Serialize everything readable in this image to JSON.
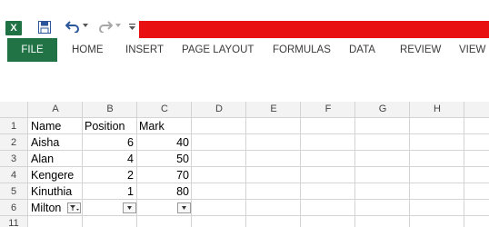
{
  "app": {
    "logo_letter": "X",
    "accent": "#217346",
    "title_bar_color": "#e81010"
  },
  "ribbon": {
    "tabs": [
      {
        "label": "FILE"
      },
      {
        "label": "HOME"
      },
      {
        "label": "INSERT"
      },
      {
        "label": "PAGE LAYOUT"
      },
      {
        "label": "FORMULAS"
      },
      {
        "label": "DATA"
      },
      {
        "label": "REVIEW"
      },
      {
        "label": "VIEW"
      }
    ]
  },
  "sheet": {
    "columns": [
      "A",
      "B",
      "C",
      "D",
      "E",
      "F",
      "G",
      "H"
    ],
    "rows": [
      "1",
      "2",
      "3",
      "4",
      "5",
      "6",
      "11"
    ],
    "cells": {
      "A1": "Name",
      "B1": "Position",
      "C1": "Mark",
      "A2": "Aisha",
      "B2": "6",
      "C2": "40",
      "A3": "Alan",
      "B3": "4",
      "C3": "50",
      "A4": "Kengere",
      "B4": "2",
      "C4": "70",
      "A5": "Kinuthia",
      "B5": "1",
      "C5": "80",
      "A6": "Milton"
    },
    "filter_icons": [
      "filter-active-icon",
      "dropdown-arrow-icon",
      "dropdown-arrow-icon"
    ]
  }
}
